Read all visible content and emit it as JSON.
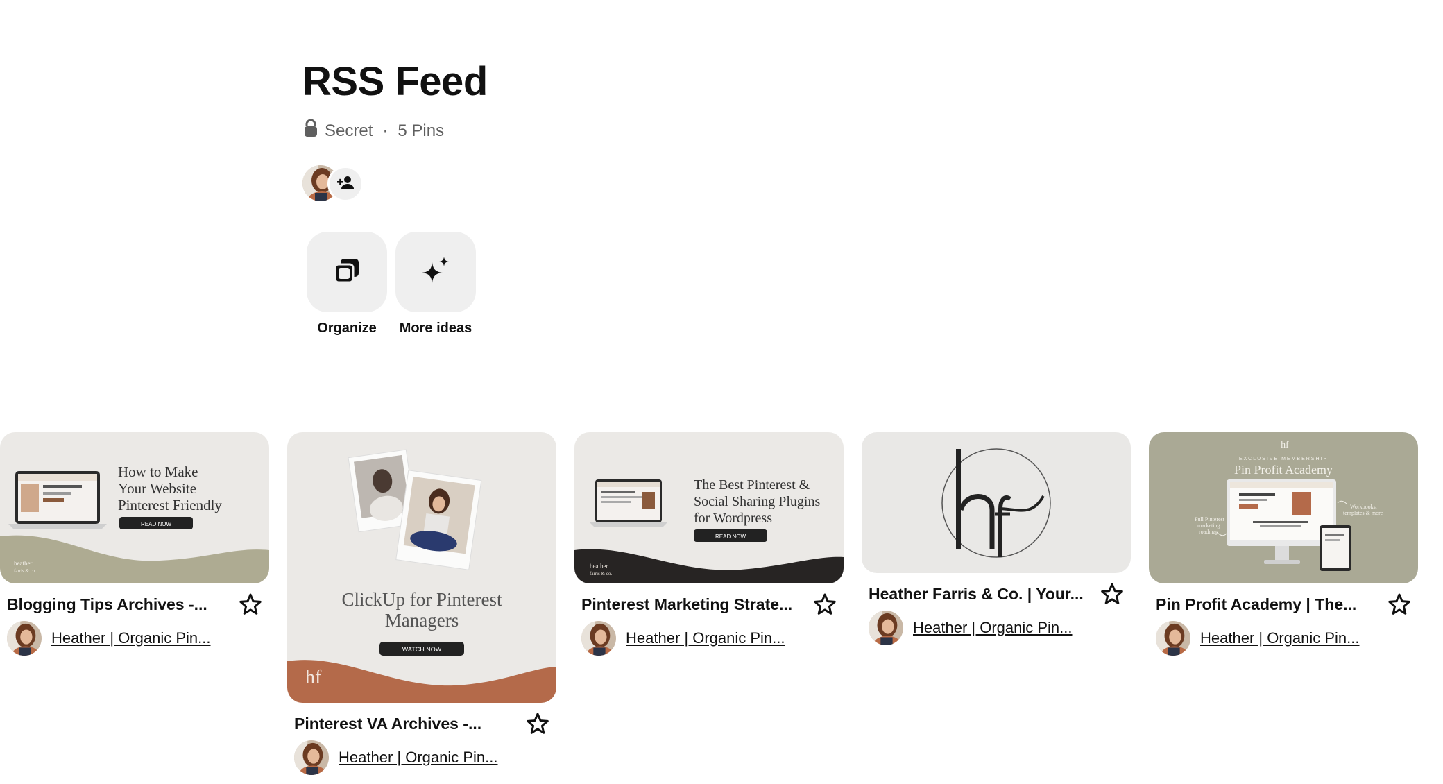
{
  "board": {
    "title": "RSS Feed",
    "privacy": "Secret",
    "separator": "·",
    "pin_count": "5 Pins",
    "icons": {
      "privacy": "lock-icon",
      "add_collaborator": "add-person-icon"
    }
  },
  "tools": [
    {
      "label": "Organize",
      "icon": "organize-icon"
    },
    {
      "label": "More ideas",
      "icon": "sparkle-icon"
    }
  ],
  "pins": [
    {
      "title": "Blogging Tips Archives -...",
      "owner": "Heather | Organic Pin...",
      "image": {
        "heading": [
          "How to Make",
          "Your Website",
          "Pinterest Friendly"
        ],
        "button": "READ NOW",
        "brand": [
          "heather",
          "farris & co."
        ],
        "bg": "#ebe9e6",
        "accent": "#aeab92"
      }
    },
    {
      "title": "Pinterest VA Archives -...",
      "owner": "Heather | Organic Pin...",
      "image": {
        "heading": [
          "ClickUp for Pinterest",
          "Managers"
        ],
        "button": "WATCH NOW",
        "brand": [
          "hf"
        ],
        "bg": "#ebe9e6",
        "accent": "#b46a4a"
      }
    },
    {
      "title": "Pinterest Marketing Strate...",
      "owner": "Heather | Organic Pin...",
      "image": {
        "heading": [
          "The Best Pinterest &",
          "Social Sharing Plugins",
          "for Wordpress"
        ],
        "button": "READ NOW",
        "brand": [
          "heather",
          "farris & co."
        ],
        "bg": "#ebe9e6",
        "accent": "#272423"
      }
    },
    {
      "title": "Heather Farris & Co. | Your...",
      "owner": "Heather | Organic Pin...",
      "image": {
        "logo": "hf",
        "bg": "#e9e8e6"
      }
    },
    {
      "title": "Pin Profit Academy | The...",
      "owner": "Heather | Organic Pin...",
      "image": {
        "kicker": "EXCLUSIVE MEMBERSHIP",
        "heading": [
          "Pin Profit Academy"
        ],
        "left_note": [
          "Full Pinterest",
          "marketing",
          "roadmap"
        ],
        "right_note": [
          "Workbooks,",
          "templates & more"
        ],
        "bg": "#aaa995"
      }
    }
  ],
  "colors": {
    "text": "#111111",
    "meta": "#5f5f5f",
    "button_bg": "#efefef",
    "background": "#ffffff"
  }
}
